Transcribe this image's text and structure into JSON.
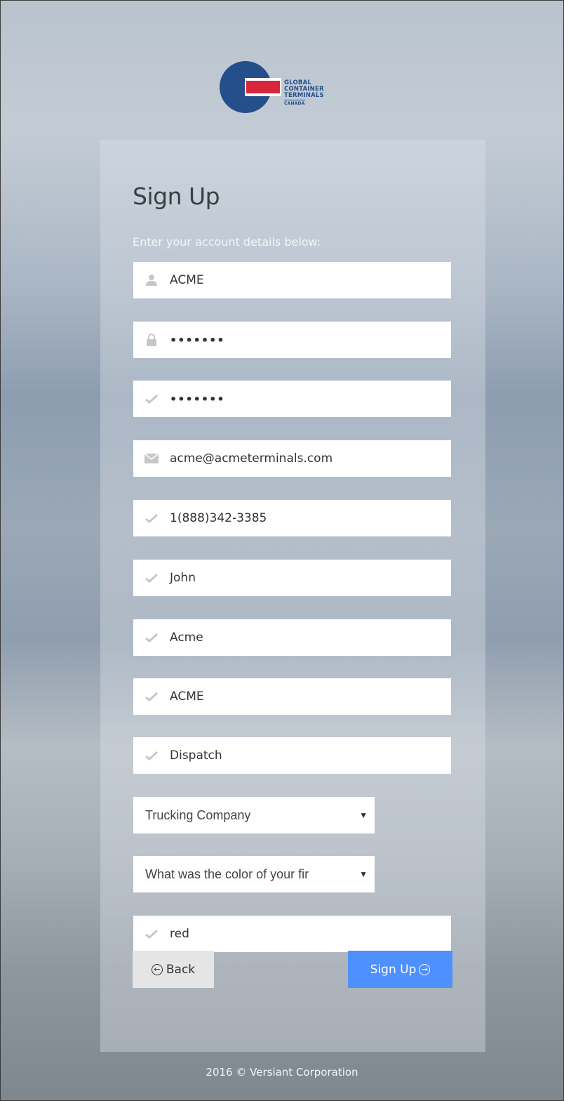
{
  "brand": {
    "logo_lines": [
      "GLOBAL",
      "CONTAINER",
      "TERMINALS"
    ],
    "logo_sub": "CANADA",
    "colors": {
      "blue": "#244f8a",
      "red": "#d9253a"
    }
  },
  "form": {
    "title": "Sign Up",
    "subtitle": "Enter your account details below:",
    "fields": [
      {
        "icon": "user-icon",
        "value": "ACME"
      },
      {
        "icon": "lock-icon",
        "value": "•••••••"
      },
      {
        "icon": "check-icon",
        "value": "•••••••"
      },
      {
        "icon": "envelope-icon",
        "value": "acme@acmeterminals.com"
      },
      {
        "icon": "check-icon",
        "value": "1(888)342-3385"
      },
      {
        "icon": "check-icon",
        "value": "John"
      },
      {
        "icon": "check-icon",
        "value": "Acme"
      },
      {
        "icon": "check-icon",
        "value": "ACME"
      },
      {
        "icon": "check-icon",
        "value": "Dispatch"
      }
    ],
    "company_type": {
      "selected": "Trucking Company"
    },
    "security_question": {
      "selected": "What was the color of your fir"
    },
    "security_answer": {
      "icon": "check-icon",
      "value": "red"
    },
    "back_label": "Back",
    "submit_label": "Sign Up",
    "submit_color": "#4d90fe"
  },
  "footer": {
    "text": "2016 © Versiant Corporation"
  }
}
